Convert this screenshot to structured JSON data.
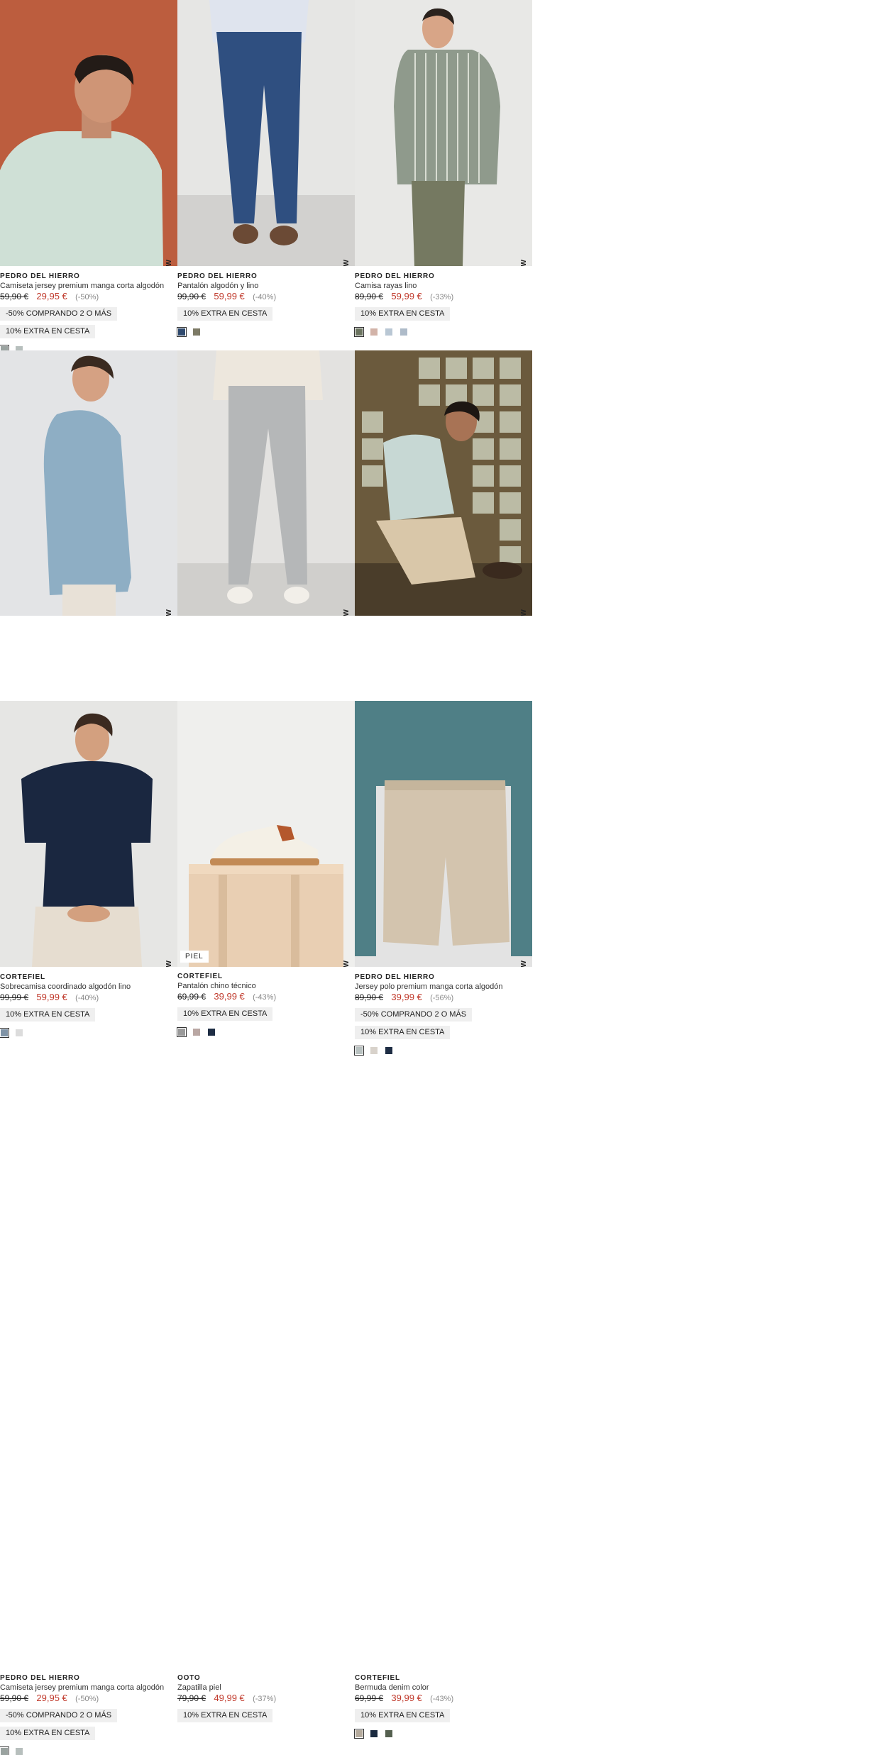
{
  "products": [
    {
      "brand": "PEDRO DEL HIERRO",
      "name": "Camiseta jersey premium manga corta algodón",
      "old_price": "59,90 €",
      "new_price": "29,95 €",
      "discount": "(-50%)",
      "badges": [
        "-50% COMPRANDO 2 O MÁS",
        "10% EXTRA EN CESTA"
      ],
      "tag": "NEW",
      "swatches": [
        "#9aa3a0",
        "#b7bfbd"
      ]
    },
    {
      "brand": "PEDRO DEL HIERRO",
      "name": "Pantalón algodón y lino",
      "old_price": "99,90 €",
      "new_price": "59,99 €",
      "discount": "(-40%)",
      "badges": [
        "10% EXTRA EN CESTA"
      ],
      "tag": "NEW",
      "swatches": [
        "#2f4a6e",
        "#7d7a66"
      ]
    },
    {
      "brand": "PEDRO DEL HIERRO",
      "name": "Camisa rayas lino",
      "old_price": "89,90 €",
      "new_price": "59,99 €",
      "discount": "(-33%)",
      "badges": [
        "10% EXTRA EN CESTA"
      ],
      "tag": "NEW",
      "swatches": [
        "#6b7460",
        "#d2b3a8",
        "#b9c7d4",
        "#aebbc9"
      ]
    },
    {
      "brand": "CORTEFIEL",
      "name": "Sobrecamisa coordinado algodón lino",
      "old_price": "99,99 €",
      "new_price": "59,99 €",
      "discount": "(-40%)",
      "badges": [
        "10% EXTRA EN CESTA"
      ],
      "tag": "NEW",
      "swatches": [
        "#7f93a6",
        "#dcdcdc"
      ]
    },
    {
      "brand": "CORTEFIEL",
      "name": "Pantalón chino técnico",
      "old_price": "69,99 €",
      "new_price": "39,99 €",
      "discount": "(-43%)",
      "badges": [
        "10% EXTRA EN CESTA"
      ],
      "tag": "NEW",
      "swatches": [
        "#9a9a9a",
        "#b9a7a3",
        "#1e2d44"
      ]
    },
    {
      "brand": "PEDRO DEL HIERRO",
      "name": "Jersey polo premium manga corta algodón",
      "old_price": "89,90 €",
      "new_price": "39,99 €",
      "discount": "(-56%)",
      "badges": [
        "-50% COMPRANDO 2 O MÁS",
        "10% EXTRA EN CESTA"
      ],
      "tag": "NEW",
      "swatches": [
        "#b8c1c0",
        "#d8d2cb",
        "#1e2d44"
      ]
    },
    {
      "brand": "PEDRO DEL HIERRO",
      "name": "Camiseta jersey premium manga corta algodón",
      "old_price": "59,90 €",
      "new_price": "29,95 €",
      "discount": "(-50%)",
      "badges": [
        "-50% COMPRANDO 2 O MÁS",
        "10% EXTRA EN CESTA"
      ],
      "tag": "NEW",
      "swatches": [
        "#9aa3a0",
        "#b7bfbd"
      ]
    },
    {
      "brand": "OOTO",
      "name": "Zapatilla piel",
      "old_price": "79,90 €",
      "new_price": "49,99 €",
      "discount": "(-37%)",
      "badges": [
        "10% EXTRA EN CESTA"
      ],
      "tag": "NEW",
      "label": "PIEL",
      "swatches": []
    },
    {
      "brand": "CORTEFIEL",
      "name": "Bermuda denim color",
      "old_price": "69,99 €",
      "new_price": "39,99 €",
      "discount": "(-43%)",
      "badges": [
        "10% EXTRA EN CESTA"
      ],
      "tag": "NEW",
      "swatches": [
        "#b4aa9c",
        "#1a2a3f",
        "#55604f"
      ]
    }
  ]
}
